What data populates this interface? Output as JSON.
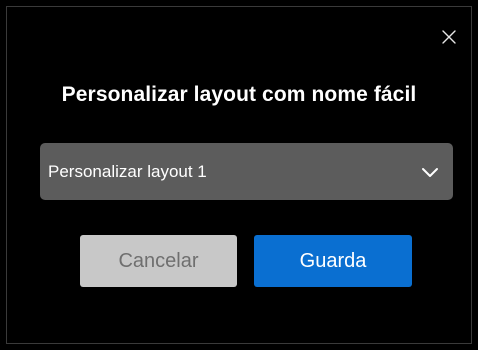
{
  "dialog": {
    "title": "Personalizar layout com nome fácil",
    "close_icon": "close-icon",
    "layout_select": {
      "selected_value": "Personalizar layout 1",
      "icon": "chevron-down-icon"
    },
    "buttons": {
      "cancel_label": "Cancelar",
      "save_label": "Guarda"
    },
    "colors": {
      "background": "#000000",
      "select_background": "#5c5c5c",
      "cancel_background": "#c8c8c8",
      "save_background": "#0a6fd1"
    }
  }
}
